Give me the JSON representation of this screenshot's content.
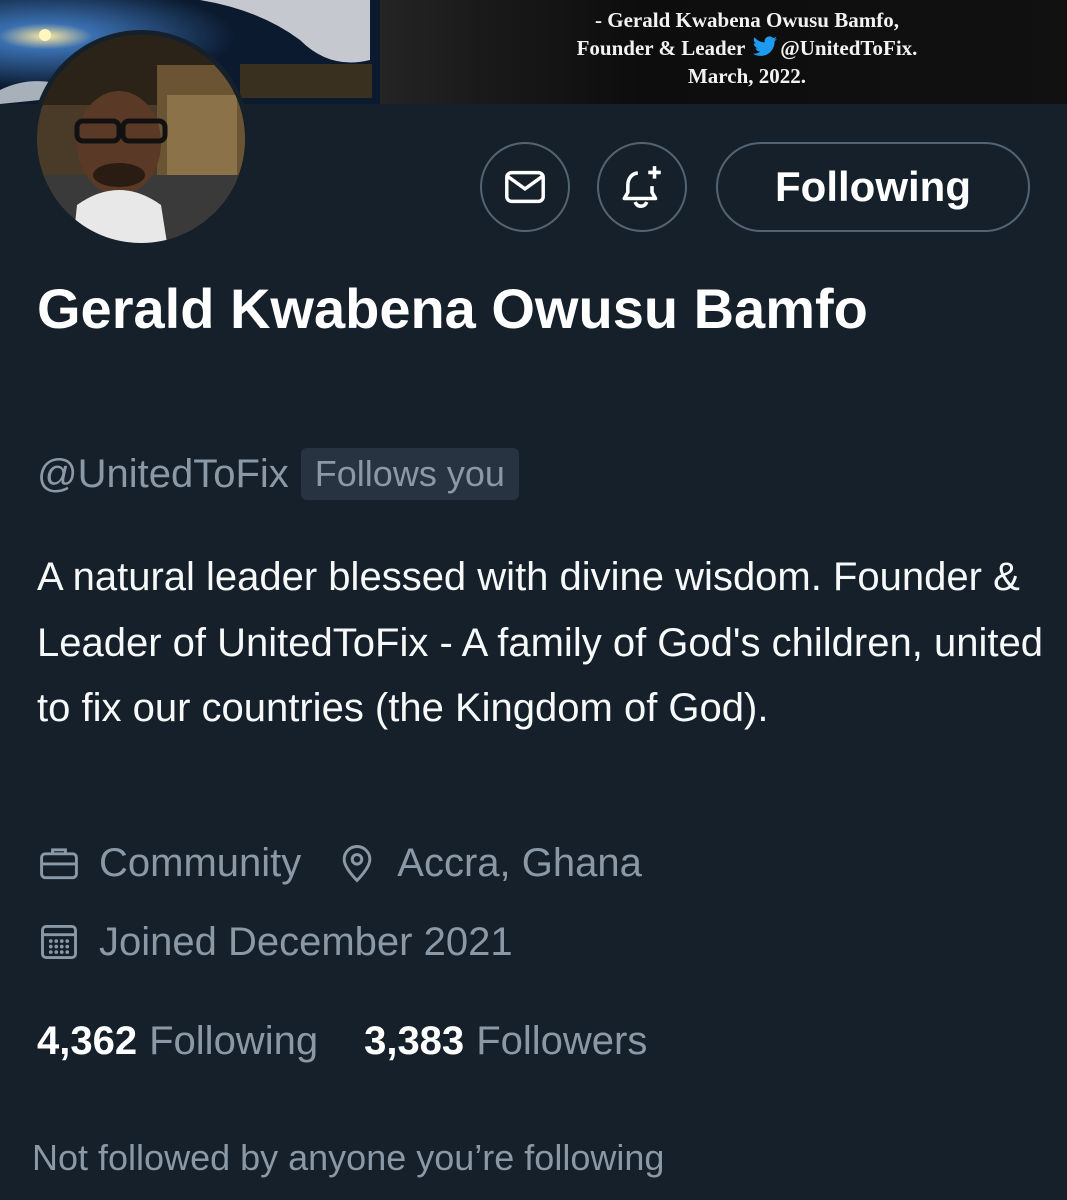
{
  "banner": {
    "quote_line1": "- Gerald Kwabena Owusu Bamfo,",
    "quote_line2_prefix": "Founder & Leader ",
    "quote_line2_handle": "@UnitedToFix.",
    "quote_line3": "March, 2022.",
    "bird_icon": "twitter-bird-icon"
  },
  "actions": {
    "message_icon": "mail-icon",
    "notify_icon": "bell-plus-icon",
    "follow_state_label": "Following"
  },
  "profile": {
    "name": "Gerald Kwabena Owusu Bamfo",
    "handle": "@UnitedToFix",
    "follows_you_badge": "Follows you",
    "bio": "A natural leader blessed with divine wisdom. Founder & Leader of UnitedToFix - A family of God's children, united to fix our countries (the Kingdom of God).",
    "category": "Community",
    "location": "Accra, Ghana",
    "joined": "Joined December 2021"
  },
  "stats": {
    "following_count": "4,362",
    "following_label": "Following",
    "followers_count": "3,383",
    "followers_label": "Followers"
  },
  "footer": {
    "mutuals_text": "Not followed by anyone you’re following"
  },
  "colors": {
    "background": "#15202b",
    "secondary_text": "#8b98a5",
    "border": "#536471",
    "twitter_blue": "#1d9bf0"
  }
}
